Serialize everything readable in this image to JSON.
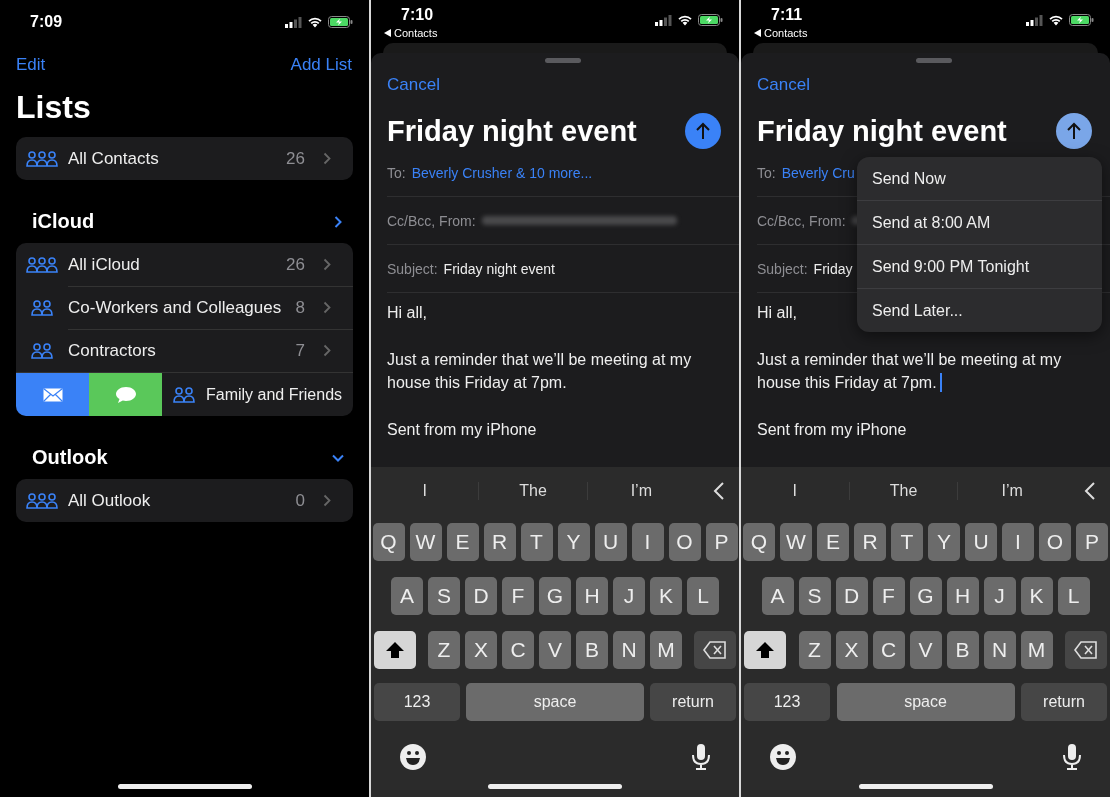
{
  "lists_screen": {
    "time": "7:09",
    "edit": "Edit",
    "add_list": "Add List",
    "title": "Lists",
    "groups": [
      {
        "rows": [
          {
            "name": "All Contacts",
            "count": "26",
            "kind": "all",
            "swiped": false
          }
        ]
      },
      {
        "heading": "iCloud",
        "expanded": false,
        "rows": [
          {
            "name": "All iCloud",
            "count": "26",
            "kind": "all",
            "swiped": false
          },
          {
            "name": "Co-Workers and Colleagues",
            "count": "8",
            "kind": "group",
            "swiped": false
          },
          {
            "name": "Contractors",
            "count": "7",
            "kind": "group",
            "swiped": false
          },
          {
            "name": "Family and Friends",
            "kind": "group",
            "swiped": true
          }
        ]
      },
      {
        "heading": "Outlook",
        "expanded": true,
        "rows": [
          {
            "name": "All Outlook",
            "count": "0",
            "kind": "all",
            "swiped": false
          }
        ]
      }
    ]
  },
  "compose_screens": [
    {
      "time": "7:10",
      "back": "Contacts",
      "cancel": "Cancel",
      "title": "Friday night event",
      "send_dimmed": false,
      "to_label": "To:",
      "to_value": "Beverly Crusher & 10 more...",
      "from_label": "Cc/Bcc, From:",
      "subject_label": "Subject:",
      "subject_value": "Friday night event",
      "paragraphs": [
        {
          "text": "Hi all,",
          "cursor": false
        },
        {
          "text": "Just a reminder that we’ll be meeting at my house this Friday at 7pm.",
          "cursor": false
        },
        {
          "text": "Sent from my iPhone",
          "cursor": false
        }
      ],
      "suggestions": [
        "I",
        "The",
        "I’m"
      ],
      "shift_on": true,
      "keys": [
        [
          "Q",
          "W",
          "E",
          "R",
          "T",
          "Y",
          "U",
          "I",
          "O",
          "P"
        ],
        [
          "A",
          "S",
          "D",
          "F",
          "G",
          "H",
          "J",
          "K",
          "L"
        ],
        [
          "Z",
          "X",
          "C",
          "V",
          "B",
          "N",
          "M"
        ]
      ],
      "numbers_key": "123",
      "space_key": "space",
      "return_key": "return"
    },
    {
      "time": "7:11",
      "back": "Contacts",
      "cancel": "Cancel",
      "title": "Friday night event",
      "send_dimmed": true,
      "to_label": "To:",
      "to_value": "Beverly Cru",
      "from_label": "Cc/Bcc, From:",
      "subject_label": "Subject:",
      "subject_value": "Friday",
      "paragraphs": [
        {
          "text": "Hi all,",
          "cursor": false
        },
        {
          "text": "Just a reminder that we’ll be meeting at my house this Friday at 7pm.",
          "cursor": true
        },
        {
          "text": "Sent from my iPhone",
          "cursor": false
        }
      ],
      "send_menu": [
        "Send Now",
        "Send at 8:00 AM",
        "Send 9:00 PM Tonight",
        "Send Later..."
      ],
      "suggestions": [
        "I",
        "The",
        "I’m"
      ],
      "shift_on": true,
      "keys": [
        [
          "Q",
          "W",
          "E",
          "R",
          "T",
          "Y",
          "U",
          "I",
          "O",
          "P"
        ],
        [
          "A",
          "S",
          "D",
          "F",
          "G",
          "H",
          "J",
          "K",
          "L"
        ],
        [
          "Z",
          "X",
          "C",
          "V",
          "B",
          "N",
          "M"
        ]
      ],
      "numbers_key": "123",
      "space_key": "space",
      "return_key": "return"
    }
  ]
}
